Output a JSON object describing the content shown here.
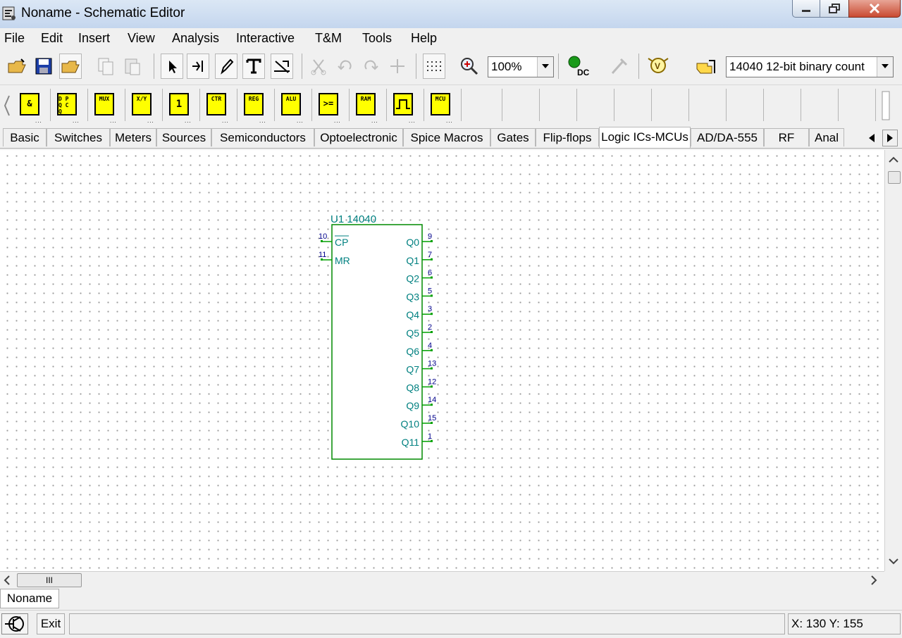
{
  "window": {
    "title": "Noname - Schematic Editor"
  },
  "menu": [
    "File",
    "Edit",
    "Insert",
    "View",
    "Analysis",
    "Interactive",
    "T&M",
    "Tools",
    "Help"
  ],
  "toolbar": {
    "zoom": "100%",
    "component_select": "14040  12-bit binary count",
    "dc_label": "DC"
  },
  "components": [
    {
      "label": "&"
    },
    {
      "label": "D P Q C Q"
    },
    {
      "label": "MUX"
    },
    {
      "label": "X/Y"
    },
    {
      "label": "1"
    },
    {
      "label": "CTR"
    },
    {
      "label": "REG"
    },
    {
      "label": "ALU"
    },
    {
      "label": ">="
    },
    {
      "label": "RAM"
    },
    {
      "label": ""
    },
    {
      "label": "MCU"
    }
  ],
  "tabs": [
    "Basic",
    "Switches",
    "Meters",
    "Sources",
    "Semiconductors",
    "Optoelectronic",
    "Spice Macros",
    "Gates",
    "Flip-flops",
    "Logic ICs-MCUs",
    "AD/DA-555",
    "RF",
    "Anal"
  ],
  "active_tab": "Logic ICs-MCUs",
  "schematic": {
    "ref": "U1 14040",
    "left_pins": [
      {
        "num": "10",
        "name": "CP"
      },
      {
        "num": "11",
        "name": "MR"
      }
    ],
    "right_pins": [
      {
        "num": "9",
        "name": "Q0"
      },
      {
        "num": "7",
        "name": "Q1"
      },
      {
        "num": "6",
        "name": "Q2"
      },
      {
        "num": "5",
        "name": "Q3"
      },
      {
        "num": "3",
        "name": "Q4"
      },
      {
        "num": "2",
        "name": "Q5"
      },
      {
        "num": "4",
        "name": "Q6"
      },
      {
        "num": "13",
        "name": "Q7"
      },
      {
        "num": "12",
        "name": "Q8"
      },
      {
        "num": "14",
        "name": "Q9"
      },
      {
        "num": "15",
        "name": "Q10"
      },
      {
        "num": "1",
        "name": "Q11"
      }
    ]
  },
  "scroll": {
    "thumb": "III"
  },
  "document_tab": "Noname",
  "status": {
    "exit": "Exit",
    "coords": "X: 130  Y: 155"
  },
  "colors": {
    "schematic": "#008080",
    "pin_number": "#00008b",
    "pin_green": "#00a000",
    "chip_yellow": "#ffff00"
  }
}
